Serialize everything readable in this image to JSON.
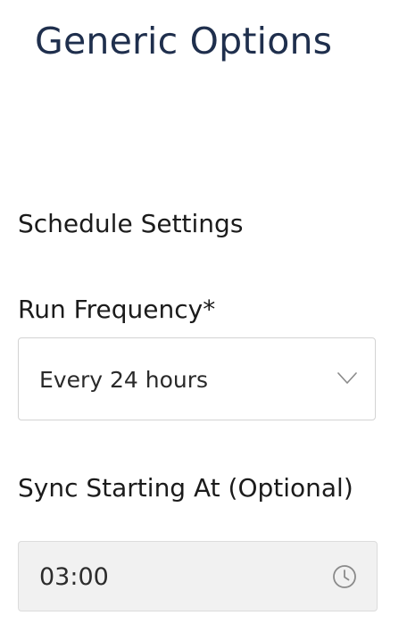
{
  "page": {
    "title": "Generic Options"
  },
  "schedule": {
    "section_title": "Schedule Settings",
    "run_frequency": {
      "label": "Run Frequency*",
      "selected": "Every 24 hours",
      "icon": "chevron-down-icon"
    },
    "sync_start": {
      "label": "Sync Starting At (Optional)",
      "value": "03:00",
      "icon": "clock-icon"
    }
  },
  "colors": {
    "title": "#1f2f4d",
    "text": "#1b1b1b",
    "border": "#d3d3d3",
    "disabled_field_bg": "#f1f1f1",
    "icon": "#8a8a8a"
  }
}
